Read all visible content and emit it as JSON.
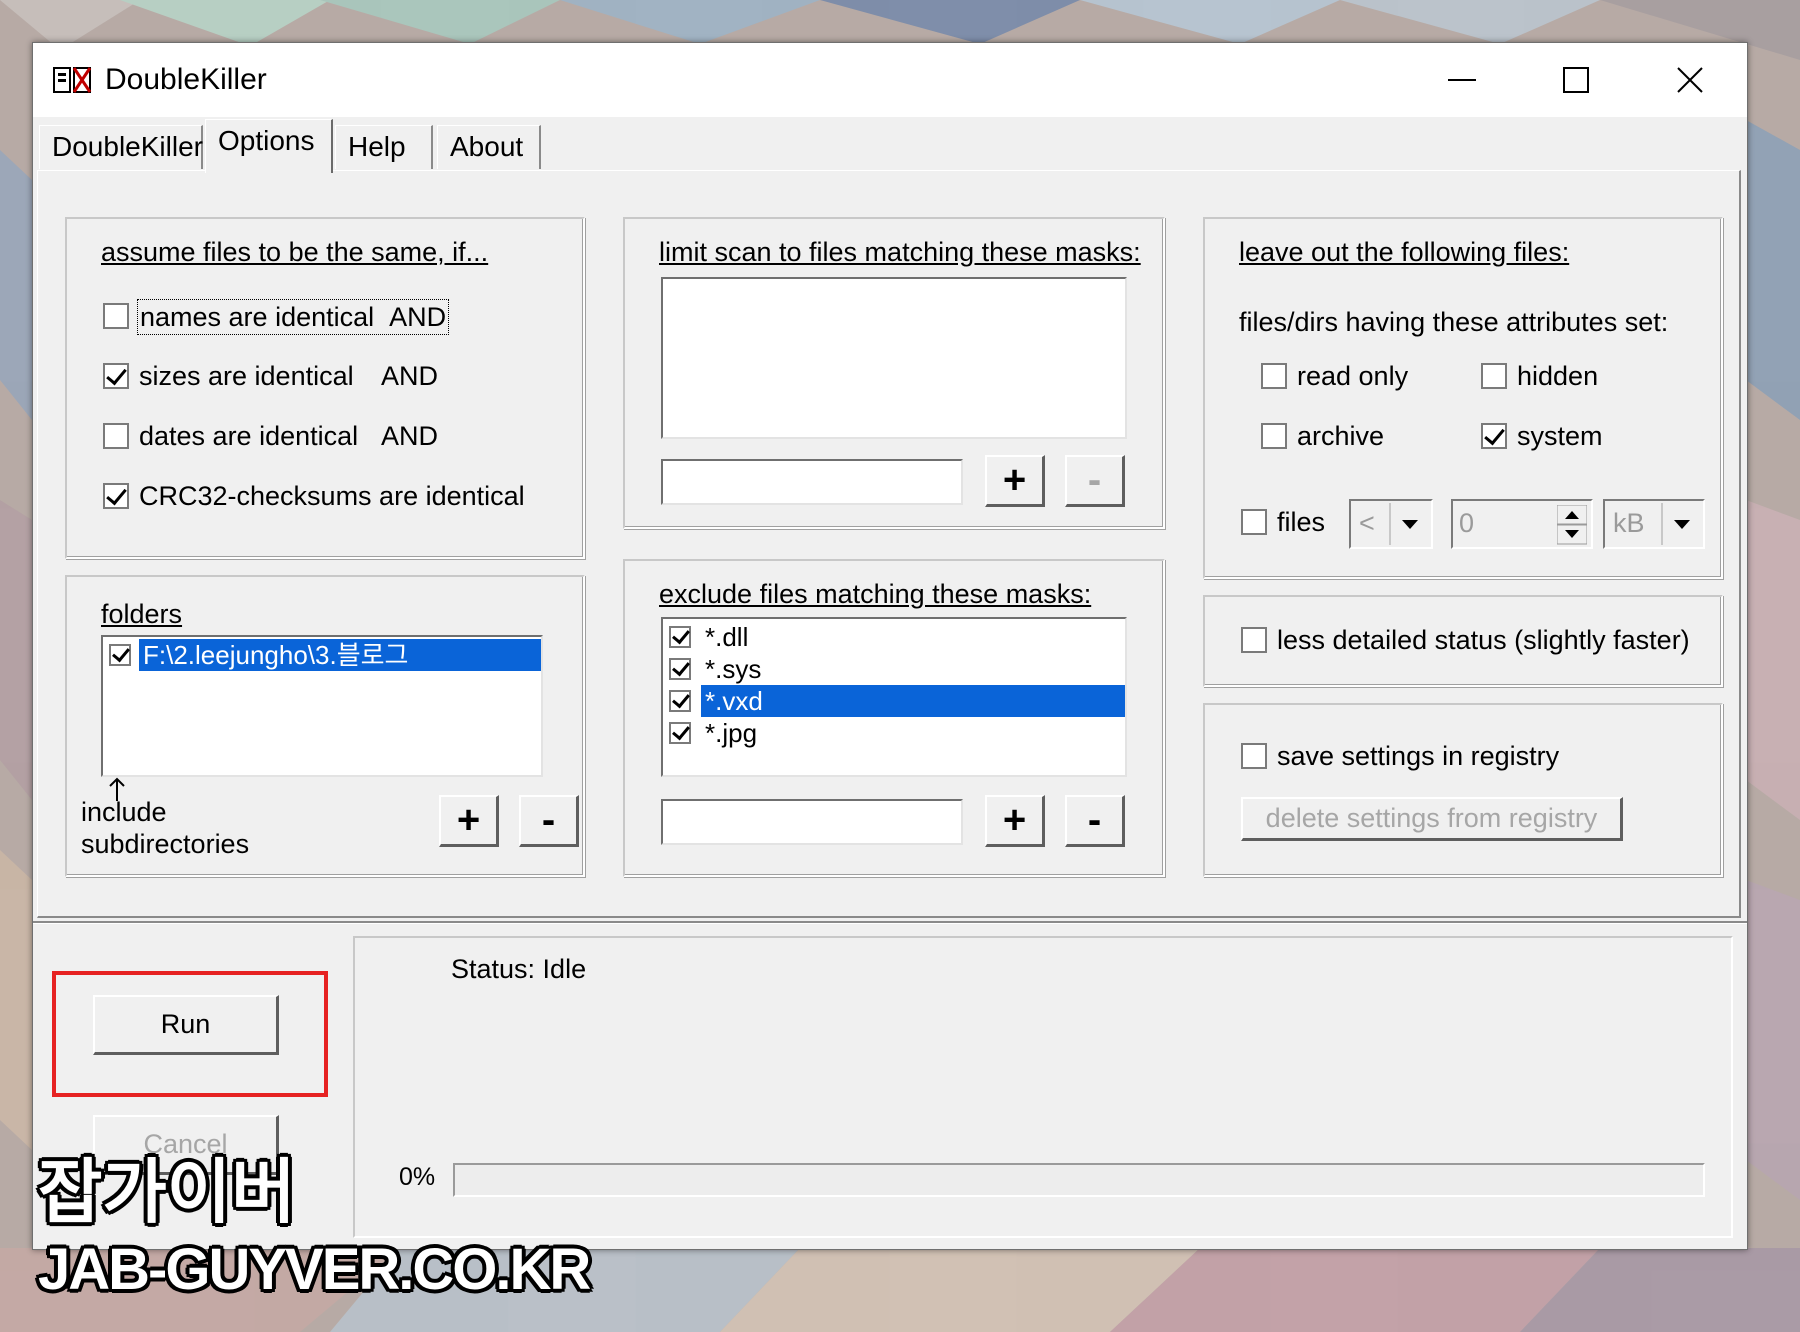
{
  "window": {
    "title": "DoubleKiller",
    "controls": {
      "minimize": "minimize",
      "maximize": "maximize",
      "close": "close"
    }
  },
  "tabs": [
    "DoubleKiller",
    "Options",
    "Help",
    "About"
  ],
  "active_tab": "Options",
  "same_criteria": {
    "heading": "assume files to be the same, if...",
    "items": [
      {
        "label": "names are identical",
        "suffix": "AND",
        "checked": false
      },
      {
        "label": "sizes are identical",
        "suffix": "AND",
        "checked": true
      },
      {
        "label": "dates are identical",
        "suffix": "AND",
        "checked": false
      },
      {
        "label": "CRC32-checksums are identical",
        "suffix": "",
        "checked": true
      }
    ]
  },
  "folders": {
    "heading": "folders",
    "items": [
      {
        "path": "F:\\2.leejungho\\3.블로그",
        "checked": true,
        "selected": true
      }
    ],
    "include_label_1": "include",
    "include_label_2": "subdirectories",
    "add": "+",
    "remove": "-"
  },
  "limit_masks": {
    "heading": "limit scan to files matching these masks:",
    "items": [],
    "input_value": "",
    "add": "+",
    "remove": "-"
  },
  "exclude_masks": {
    "heading": "exclude files matching these masks:",
    "items": [
      {
        "mask": "*.dll",
        "checked": true,
        "selected": false
      },
      {
        "mask": "*.sys",
        "checked": true,
        "selected": false
      },
      {
        "mask": "*.vxd",
        "checked": true,
        "selected": true
      },
      {
        "mask": "*.jpg",
        "checked": true,
        "selected": false
      }
    ],
    "input_value": "",
    "add": "+",
    "remove": "-"
  },
  "leave_out": {
    "heading": "leave out the following files:",
    "attributes_label": "files/dirs having these attributes set:",
    "read_only": {
      "label": "read only",
      "checked": false
    },
    "hidden": {
      "label": "hidden",
      "checked": false
    },
    "archive": {
      "label": "archive",
      "checked": false
    },
    "system": {
      "label": "system",
      "checked": true
    },
    "files": {
      "label": "files",
      "checked": false,
      "comparator": "<",
      "size_value": "0",
      "unit": "kB"
    }
  },
  "less_detailed": {
    "label": "less detailed status (slightly faster)",
    "checked": false
  },
  "registry": {
    "save_label": "save settings in registry",
    "save_checked": false,
    "delete_button": "delete settings from registry"
  },
  "actions": {
    "run": "Run",
    "cancel": "Cancel"
  },
  "status": {
    "text": "Status: Idle",
    "progress_label": "0%",
    "progress": 0
  },
  "watermark": {
    "line1": "잡가이버",
    "line2": "JAB-GUYVER.CO.KR"
  },
  "colors": {
    "selection": "#0a64d8",
    "highlight_box": "#e62222",
    "window_bg": "#f0f0f0"
  }
}
